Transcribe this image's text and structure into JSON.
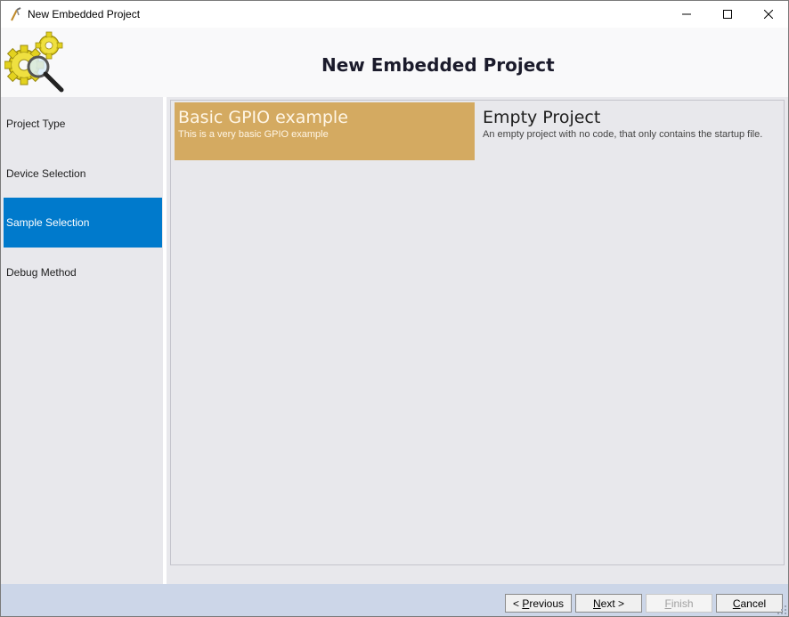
{
  "window": {
    "title": "New Embedded Project",
    "icon": "compass-tool-icon",
    "controls": [
      "minimize-icon",
      "maximize-icon",
      "close-icon"
    ]
  },
  "header": {
    "title": "New Embedded Project",
    "logo": "gears-magnifier-icon"
  },
  "sidebar": {
    "items": [
      {
        "label": "Project Type",
        "active": false
      },
      {
        "label": "Device Selection",
        "active": false
      },
      {
        "label": "Sample Selection",
        "active": true
      },
      {
        "label": "Debug Method",
        "active": false
      }
    ]
  },
  "samples": [
    {
      "title": "Basic GPIO example",
      "description": "This is a very basic GPIO example",
      "selected": true
    },
    {
      "title": "Empty Project",
      "description": "An empty project with no code, that only contains the startup file.",
      "selected": false
    }
  ],
  "footer": {
    "previous_prefix": "< ",
    "previous_hot": "P",
    "previous_rest": "revious",
    "next_hot": "N",
    "next_rest": "ext >",
    "finish_hot": "F",
    "finish_rest": "inish",
    "cancel_hot": "C",
    "cancel_rest": "ancel"
  },
  "colors": {
    "accent_selected": "#007acc",
    "tile_selected": "#d4aa61",
    "panel_bg": "#e8e8ec",
    "footer_bg": "#ccd6e8"
  }
}
